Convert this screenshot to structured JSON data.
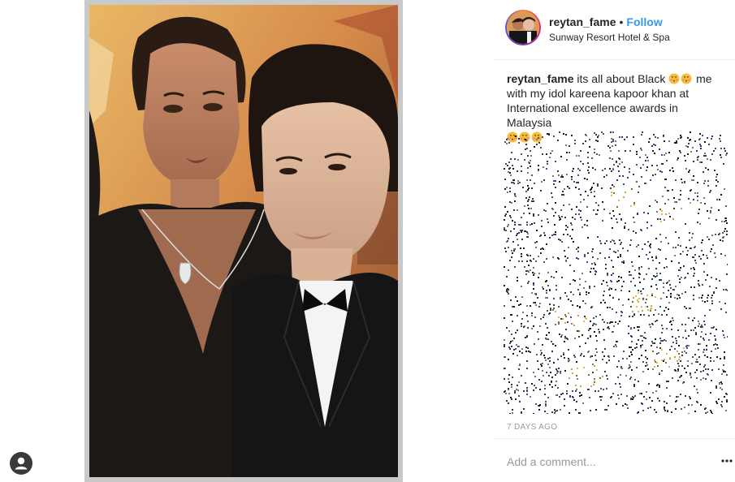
{
  "post": {
    "username": "reytan_fame",
    "separator": "•",
    "follow_label": "Follow",
    "location": "Sunway Resort Hotel & Spa",
    "caption": {
      "username": "reytan_fame",
      "text_part1": " its all about Black ",
      "text_part2": " me with my idol kareena kapoor khan at International excellence awards in Malaysia",
      "emoji_name": "kissing-face-with-blush",
      "emoji_count_after_black": 2,
      "emoji_count_end": 3
    },
    "timestamp": "7 DAYS AGO",
    "comment_placeholder": "Add a comment...",
    "more_icon": "ellipsis-icon"
  },
  "sidebar": {
    "profile_icon": "user-avatar-icon"
  },
  "colors": {
    "link_blue": "#3897f0",
    "muted_text": "#999999",
    "photo_border": "#c9c9c9"
  }
}
